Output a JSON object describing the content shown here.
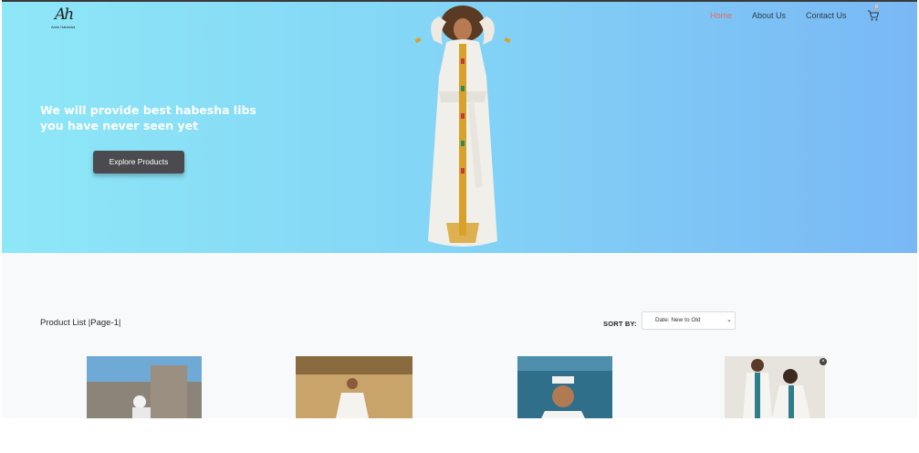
{
  "header": {
    "logo_mark": "Ah",
    "logo_sub": "Amin Habesha",
    "nav": [
      {
        "label": "Home",
        "active": true
      },
      {
        "label": "About Us",
        "active": false
      },
      {
        "label": "Contact Us",
        "active": false
      }
    ],
    "cart_count": "0",
    "cart_icon": "cart-icon"
  },
  "hero": {
    "headline_line1": "We will provide best habesha libs",
    "headline_line2": "you have never seen yet",
    "cta_label": "Explore Products"
  },
  "products": {
    "title": "Product List |Page-1|",
    "sort_label": "SORT BY:",
    "sort_value": "Date: New to Old",
    "close_label": "×"
  },
  "colors": {
    "hero_start": "#8ee7f7",
    "hero_end": "#79b8f5",
    "nav_active": "#e56b5e",
    "button_bg": "#4b4b4f"
  }
}
